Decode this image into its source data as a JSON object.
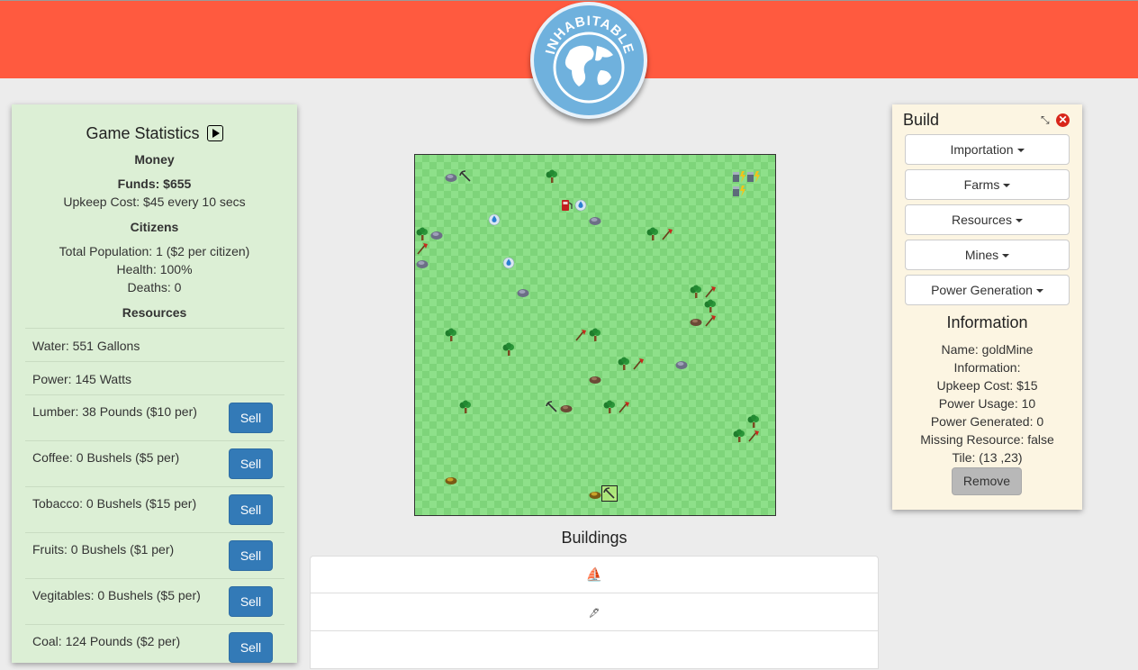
{
  "header": {
    "logo_text": "INHABITABLE"
  },
  "stats": {
    "title": "Game Statistics",
    "money_heading": "Money",
    "funds": "Funds: $655",
    "upkeep": "Upkeep Cost: $45 every 10 secs",
    "citizens_heading": "Citizens",
    "population": "Total Population: 1 ($2 per citizen)",
    "health": "Health: 100%",
    "deaths": "Deaths: 0",
    "resources_heading": "Resources",
    "resources": [
      {
        "label": "Water: 551 Gallons",
        "sell": false
      },
      {
        "label": "Power: 145 Watts",
        "sell": false
      },
      {
        "label": "Lumber: 38 Pounds ($10 per)",
        "sell": true,
        "sell_label": "Sell"
      },
      {
        "label": "Coffee: 0 Bushels ($5 per)",
        "sell": true,
        "sell_label": "Sell"
      },
      {
        "label": "Tobacco: 0 Bushels ($15 per)",
        "sell": true,
        "sell_label": "Sell"
      },
      {
        "label": "Fruits: 0 Bushels ($1 per)",
        "sell": true,
        "sell_label": "Sell"
      },
      {
        "label": "Vegitables: 0 Bushels ($5 per)",
        "sell": true,
        "sell_label": "Sell"
      },
      {
        "label": "Coal: 124 Pounds ($2 per)",
        "sell": true,
        "sell_label": "Sell"
      }
    ]
  },
  "map": {
    "grid_size": 25,
    "tiles": [
      {
        "c": 2,
        "r": 1,
        "t": "rock"
      },
      {
        "c": 3,
        "r": 1,
        "t": "pick"
      },
      {
        "c": 9,
        "r": 1,
        "t": "tree"
      },
      {
        "c": 22,
        "r": 1,
        "t": "battery"
      },
      {
        "c": 23,
        "r": 1,
        "t": "battery"
      },
      {
        "c": 22,
        "r": 2,
        "t": "battery"
      },
      {
        "c": 10,
        "r": 3,
        "t": "pump"
      },
      {
        "c": 11,
        "r": 3,
        "t": "drop"
      },
      {
        "c": 5,
        "r": 4,
        "t": "drop"
      },
      {
        "c": 12,
        "r": 4,
        "t": "rock"
      },
      {
        "c": 0,
        "r": 5,
        "t": "tree"
      },
      {
        "c": 1,
        "r": 5,
        "t": "rock"
      },
      {
        "c": 16,
        "r": 5,
        "t": "tree"
      },
      {
        "c": 17,
        "r": 5,
        "t": "axe"
      },
      {
        "c": 0,
        "r": 6,
        "t": "axe"
      },
      {
        "c": 0,
        "r": 7,
        "t": "rock"
      },
      {
        "c": 6,
        "r": 7,
        "t": "drop"
      },
      {
        "c": 7,
        "r": 9,
        "t": "rock"
      },
      {
        "c": 19,
        "r": 9,
        "t": "tree"
      },
      {
        "c": 20,
        "r": 9,
        "t": "axe"
      },
      {
        "c": 20,
        "r": 10,
        "t": "tree"
      },
      {
        "c": 19,
        "r": 11,
        "t": "ore"
      },
      {
        "c": 20,
        "r": 11,
        "t": "axe"
      },
      {
        "c": 2,
        "r": 12,
        "t": "tree"
      },
      {
        "c": 11,
        "r": 12,
        "t": "axe"
      },
      {
        "c": 12,
        "r": 12,
        "t": "tree"
      },
      {
        "c": 6,
        "r": 13,
        "t": "tree"
      },
      {
        "c": 14,
        "r": 14,
        "t": "tree"
      },
      {
        "c": 15,
        "r": 14,
        "t": "axe"
      },
      {
        "c": 18,
        "r": 14,
        "t": "rock"
      },
      {
        "c": 12,
        "r": 15,
        "t": "ore"
      },
      {
        "c": 3,
        "r": 17,
        "t": "tree"
      },
      {
        "c": 9,
        "r": 17,
        "t": "pick"
      },
      {
        "c": 10,
        "r": 17,
        "t": "ore"
      },
      {
        "c": 13,
        "r": 17,
        "t": "tree"
      },
      {
        "c": 14,
        "r": 17,
        "t": "axe"
      },
      {
        "c": 23,
        "r": 18,
        "t": "tree"
      },
      {
        "c": 22,
        "r": 19,
        "t": "tree"
      },
      {
        "c": 23,
        "r": 19,
        "t": "axe"
      },
      {
        "c": 2,
        "r": 22,
        "t": "gold"
      },
      {
        "c": 12,
        "r": 23,
        "t": "gold"
      },
      {
        "c": 13,
        "r": 23,
        "t": "pick",
        "selected": true
      }
    ]
  },
  "buildings": {
    "title": "Buildings",
    "rows": [
      {
        "icon": "ship-icon",
        "glyph": "⛵"
      },
      {
        "icon": "tool-icon",
        "glyph": "🖋"
      },
      {
        "icon": "item-icon",
        "glyph": ""
      }
    ]
  },
  "build": {
    "title": "Build",
    "menus": [
      {
        "label": "Importation"
      },
      {
        "label": "Farms"
      },
      {
        "label": "Resources"
      },
      {
        "label": "Mines"
      },
      {
        "label": "Power Generation"
      }
    ],
    "info_title": "Information",
    "info": [
      "Name: goldMine",
      "Information:",
      "Upkeep Cost: $15",
      "Power Usage: 10",
      "Power Generated: 0",
      "Missing Resource: false",
      "Tile: (13 ,23)"
    ],
    "remove_label": "Remove"
  },
  "colors": {
    "header": "#ff5a3f",
    "sell_button": "#337ab7",
    "stats_bg": "#dcefd5",
    "build_bg": "#fcf5e2"
  }
}
